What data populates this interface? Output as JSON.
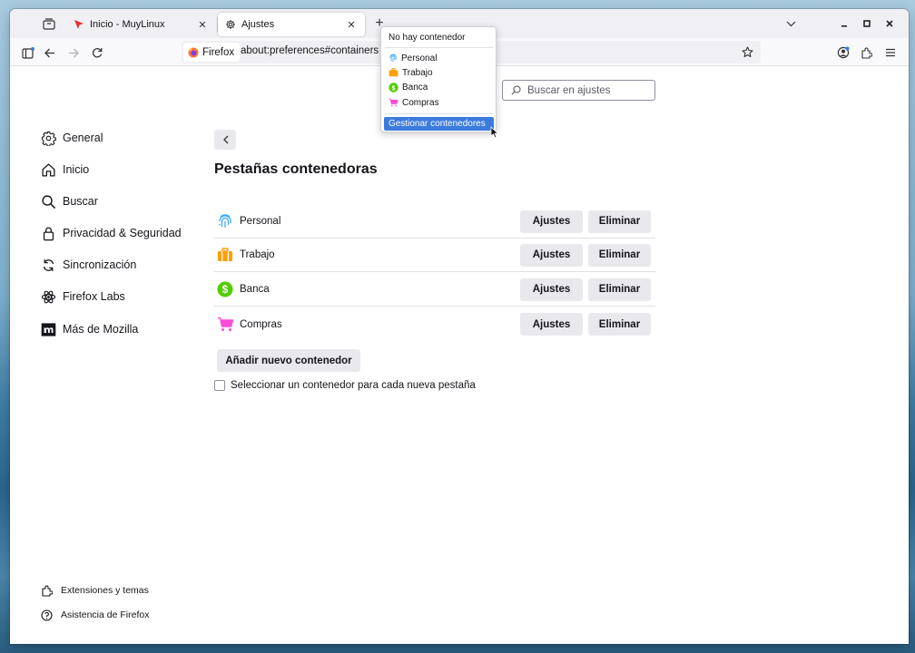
{
  "tabs": [
    {
      "title": "Inicio - MuyLinux",
      "active": false,
      "icon": "muylinux-arrow-icon"
    },
    {
      "title": "Ajustes",
      "active": true,
      "icon": "gear-icon"
    }
  ],
  "navbar": {
    "identity_label": "Firefox",
    "url": "about:preferences#containers"
  },
  "search": {
    "placeholder": "Buscar en ajustes"
  },
  "sidebar": {
    "items": [
      {
        "label": "General",
        "icon": "gear-icon"
      },
      {
        "label": "Inicio",
        "icon": "home-icon"
      },
      {
        "label": "Buscar",
        "icon": "search-icon"
      },
      {
        "label": "Privacidad & Seguridad",
        "icon": "lock-icon"
      },
      {
        "label": "Sincronización",
        "icon": "sync-icon"
      },
      {
        "label": "Firefox Labs",
        "icon": "labs-icon"
      },
      {
        "label": "Más de Mozilla",
        "icon": "mozilla-icon"
      }
    ],
    "footer": [
      {
        "label": "Extensiones y temas",
        "icon": "puzzle-icon"
      },
      {
        "label": "Asistencia de Firefox",
        "icon": "help-icon"
      }
    ]
  },
  "main": {
    "title": "Pestañas contenedoras",
    "containers": [
      {
        "name": "Personal",
        "color": "#37adff",
        "icon": "fingerprint-icon"
      },
      {
        "name": "Trabajo",
        "color": "#ff9f00",
        "icon": "briefcase-icon"
      },
      {
        "name": "Banca",
        "color": "#51cd00",
        "icon": "dollar-icon"
      },
      {
        "name": "Compras",
        "color": "#ff4bda",
        "icon": "cart-icon"
      }
    ],
    "settings_label": "Ajustes",
    "remove_label": "Eliminar",
    "add_label": "Añadir nuevo contenedor",
    "checkbox_label": "Seleccionar un contenedor para cada nueva pestaña"
  },
  "popup": {
    "no_container": "No hay contenedor",
    "items": [
      {
        "name": "Personal"
      },
      {
        "name": "Trabajo"
      },
      {
        "name": "Banca"
      },
      {
        "name": "Compras"
      }
    ],
    "manage_label": "Gestionar contenedores"
  },
  "colors": {
    "accent": "#3b7bde",
    "tabstrip_bg": "#f0f0f4",
    "button_bg": "#e9e9ed"
  }
}
